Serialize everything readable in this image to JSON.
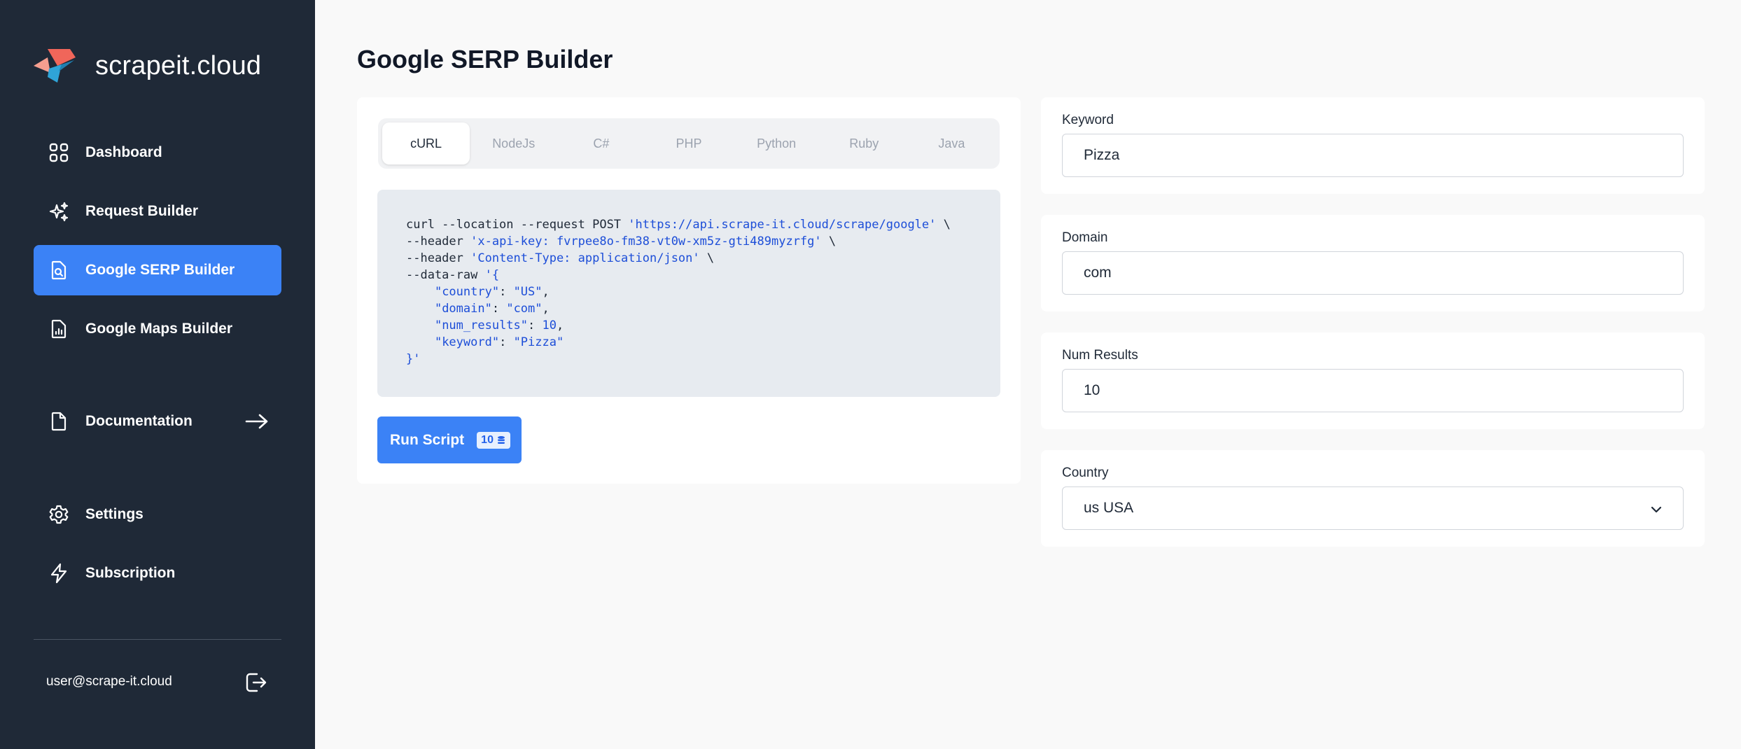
{
  "brand": {
    "name": "scrapeit.cloud"
  },
  "sidebar": {
    "items": [
      {
        "label": "Dashboard",
        "icon": "grid-icon"
      },
      {
        "label": "Request Builder",
        "icon": "sparkles-icon"
      },
      {
        "label": "Google SERP Builder",
        "icon": "document-search-icon",
        "active": true
      },
      {
        "label": "Google Maps Builder",
        "icon": "document-chart-icon"
      },
      {
        "label": "Documentation",
        "icon": "document-icon"
      },
      {
        "label": "Settings",
        "icon": "gear-icon"
      },
      {
        "label": "Subscription",
        "icon": "lightning-icon"
      }
    ],
    "user_email": "user@scrape-it.cloud"
  },
  "main": {
    "title": "Google SERP Builder",
    "tabs": [
      "cURL",
      "NodeJs",
      "C#",
      "PHP",
      "Python",
      "Ruby",
      "Java"
    ],
    "active_tab": "cURL",
    "code": {
      "l1_cmd": "curl --location --request POST ",
      "l1_url": "'https://api.scrape-it.cloud/scrape/google'",
      "l2_cmd": "--header ",
      "l2_val": "'x-api-key: fvrpee8o-fm38-vt0w-xm5z-gti489myzrfg'",
      "l3_cmd": "--header ",
      "l3_val": "'Content-Type: application/json'",
      "l4_cmd": "--data-raw ",
      "l4_val": "'{",
      "l5_key": "\"country\"",
      "l5_val": "\"US\"",
      "l6_key": "\"domain\"",
      "l6_val": "\"com\"",
      "l7_key": "\"num_results\"",
      "l7_val": "10",
      "l8_key": "\"keyword\"",
      "l8_val": "\"Pizza\"",
      "l9": "}'"
    },
    "run_button": {
      "label": "Run Script",
      "credits": "10"
    }
  },
  "form": {
    "keyword": {
      "label": "Keyword",
      "value": "Pizza"
    },
    "domain": {
      "label": "Domain",
      "value": "com"
    },
    "num_results": {
      "label": "Num Results",
      "value": "10"
    },
    "country": {
      "label": "Country",
      "value": "us USA"
    }
  },
  "colors": {
    "sidebar_bg": "#1f2937",
    "accent": "#3b82f6",
    "logo_red": "#f0665a",
    "logo_blue": "#2fa4d8"
  }
}
